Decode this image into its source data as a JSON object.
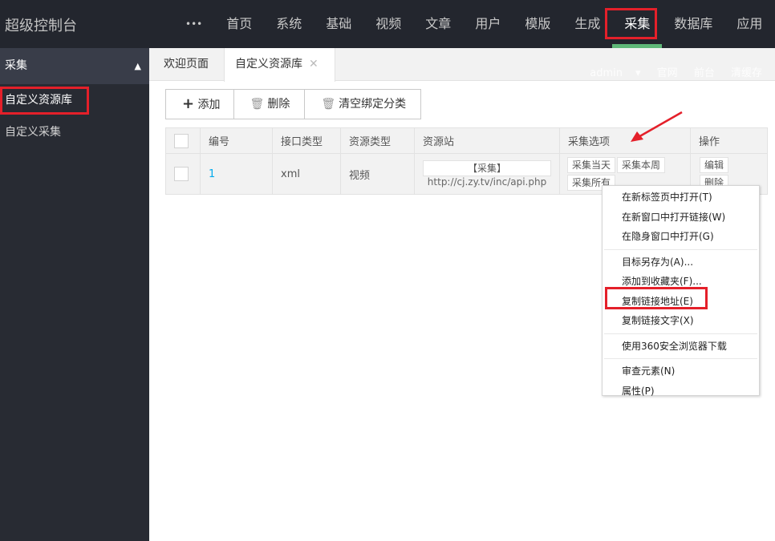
{
  "header": {
    "title": "超级控制台",
    "more": "•••",
    "nav": [
      "首页",
      "系统",
      "基础",
      "视频",
      "文章",
      "用户",
      "模版",
      "生成",
      "采集",
      "数据库",
      "应用"
    ],
    "active": "采集"
  },
  "sidebar": {
    "group": "采集",
    "items": [
      "自定义资源库",
      "自定义采集"
    ]
  },
  "tabs": [
    {
      "label": "欢迎页面"
    },
    {
      "label": "自定义资源库",
      "close": "✕"
    }
  ],
  "userlinks": {
    "user": "admin",
    "dropdown": "▾",
    "links": [
      "官网",
      "前台",
      "清缓存"
    ]
  },
  "toolbar": {
    "add": "添加",
    "delete": "删除",
    "clear": "清空绑定分类"
  },
  "table": {
    "headers": [
      "编号",
      "接口类型",
      "资源类型",
      "资源站",
      "采集选项",
      "操作"
    ],
    "rows": [
      {
        "id": "1",
        "api_type": "xml",
        "res_type": "视频",
        "site_btn": "【采集】",
        "site_url": "http://cj.zy.tv/inc/api.php",
        "options": [
          "采集当天",
          "采集本周",
          "采集所有"
        ],
        "actions": [
          "编辑",
          "删除"
        ]
      }
    ]
  },
  "context_menu": {
    "groups": [
      [
        "在新标签页中打开(T)",
        "在新窗口中打开链接(W)",
        "在隐身窗口中打开(G)"
      ],
      [
        "目标另存为(A)...",
        "添加到收藏夹(F)...",
        "复制链接地址(E)",
        "复制链接文字(X)"
      ],
      [
        "使用360安全浏览器下载"
      ],
      [
        "审查元素(N)",
        "属性(P)"
      ]
    ]
  },
  "colors": {
    "header_bg": "#23262e",
    "sidebar_bg": "#282b33",
    "accent": "#5fb878",
    "highlight": "#e4202a"
  }
}
